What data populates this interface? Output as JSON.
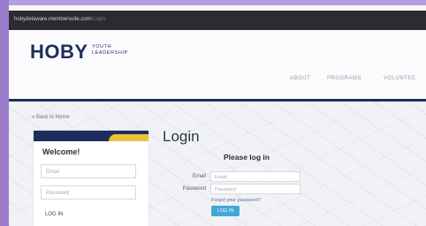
{
  "browser": {
    "url_host": "hobydelaware.membersuite.com",
    "url_path": "/Login"
  },
  "header": {
    "logo_text": "HOBY",
    "logo_subtitle_line1": "YOUTH",
    "logo_subtitle_line2": "LEADERSHIP",
    "nav": {
      "about": "ABOUT",
      "programs": "PROGRAMS",
      "volunteer": "VOLUNTEE"
    }
  },
  "sidebar": {
    "back_link": "« Back to Home",
    "welcome": "Welcome!",
    "email_placeholder": "Email",
    "password_placeholder": "Password",
    "login_label": "LOG IN"
  },
  "main": {
    "title": "Login",
    "subtitle": "Please log in",
    "email_label": "Email",
    "email_placeholder": "Email",
    "password_label": "Password",
    "password_placeholder": "Password",
    "forgot_link": "Forgot your password?",
    "login_button": "LOG IN"
  }
}
